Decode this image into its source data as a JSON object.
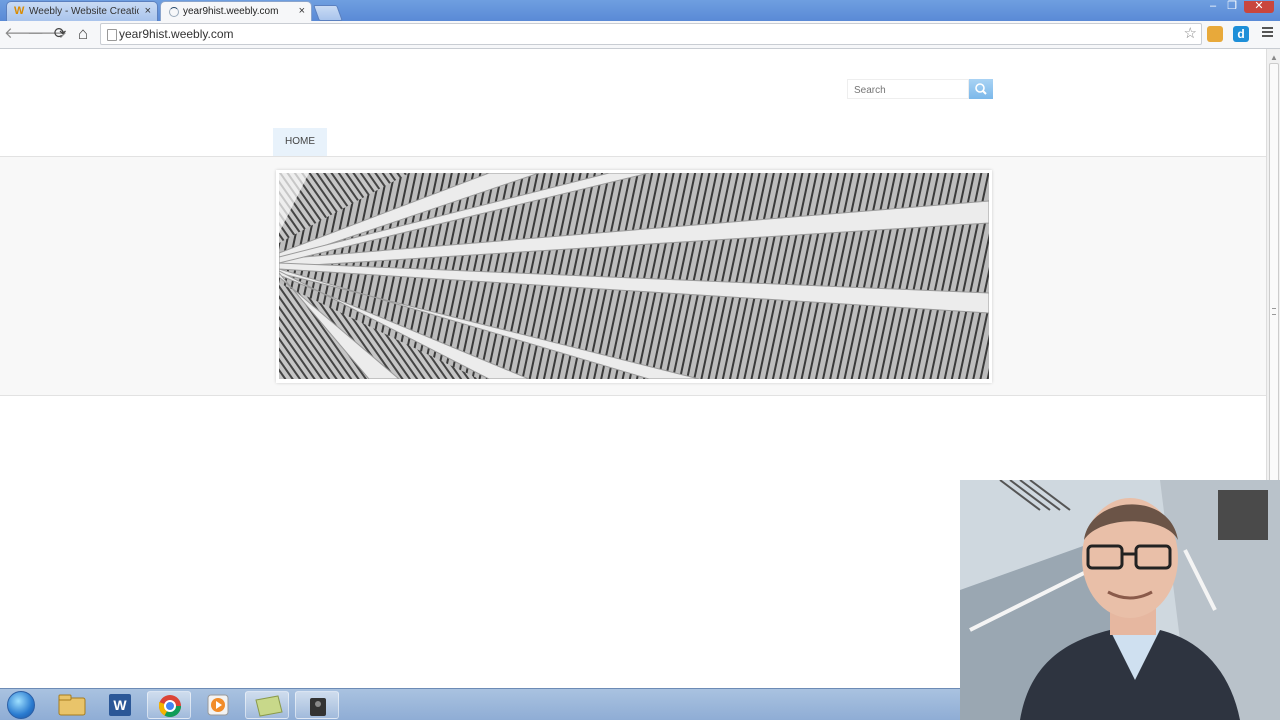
{
  "browser": {
    "tabs": [
      {
        "title": "Weebly - Website Creation",
        "favicon": "weebly-w-icon",
        "favicon_text": "W",
        "active": false
      },
      {
        "title": "year9hist.weebly.com",
        "favicon": "loading-spinner-icon",
        "active": true
      }
    ],
    "close_glyph": "×",
    "url": "year9hist.weebly.com",
    "nav_glyphs": {
      "back": "🡐",
      "forward": "🡒",
      "reload": "⟳",
      "home": "⌂",
      "star": "☆"
    }
  },
  "page": {
    "search": {
      "placeholder": "Search"
    },
    "nav": [
      {
        "label": "HOME"
      }
    ],
    "banner": {
      "description_icon": "wooden-ceiling-rays-image"
    }
  },
  "taskbar": {
    "items": [
      "start-orb",
      "file-explorer-icon",
      "word-icon",
      "chrome-icon",
      "media-player-icon",
      "notes-icon",
      "camera-app-icon"
    ]
  },
  "overlay": {
    "type": "webcam-presenter-video"
  },
  "colors": {
    "tab_strip": "#6f9fe0",
    "nav_highlight": "#e8f2fb",
    "search_button": "#7bb8ea",
    "taskbar": "#a9c2e0"
  }
}
